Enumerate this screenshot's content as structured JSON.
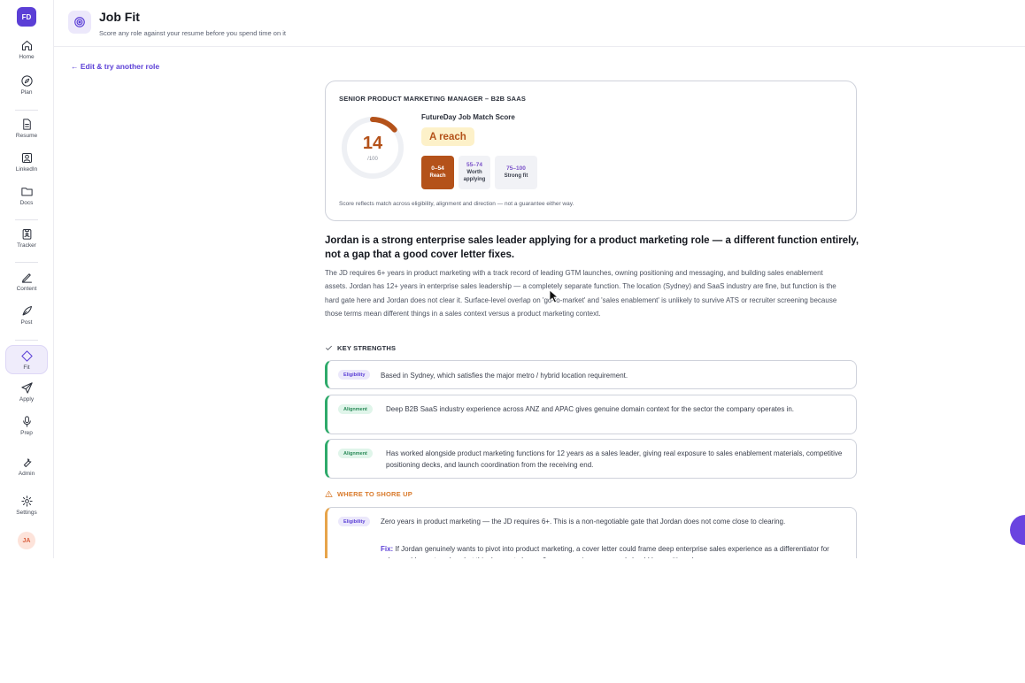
{
  "sidebar": {
    "brand": "FD",
    "items": [
      {
        "label": "Home"
      },
      {
        "label": "Plan"
      },
      {
        "label": "Resume"
      },
      {
        "label": "LinkedIn"
      },
      {
        "label": "Docs"
      },
      {
        "label": "Tracker"
      },
      {
        "label": "Content"
      },
      {
        "label": "Post"
      },
      {
        "label": "Fit"
      },
      {
        "label": "Apply"
      },
      {
        "label": "Prep"
      },
      {
        "label": "Admin"
      },
      {
        "label": "Settings"
      }
    ],
    "avatar": "JA"
  },
  "header": {
    "title": "Job Fit",
    "subtitle": "Score any role against your resume before you spend time on it"
  },
  "back_link": "← Edit & try another role",
  "score_card": {
    "role": "SENIOR PRODUCT MARKETING MANAGER – B2B SAAS",
    "score": "14",
    "score_max": "/100",
    "score_fraction": 0.14,
    "score_label": "FutureDay Job Match Score",
    "verdict": "A reach",
    "bands": [
      {
        "range": "0–54",
        "name": "Reach"
      },
      {
        "range": "55–74",
        "name_line1": "Worth",
        "name_line2": "applying"
      },
      {
        "range": "75–100",
        "name": "Strong fit"
      }
    ],
    "note": "Score reflects match across eligibility, alignment and direction — not a guarantee either way."
  },
  "assessment": {
    "headline": "Jordan is a strong enterprise sales leader applying for a product marketing role — a different function entirely, not a gap that a good cover letter fixes.",
    "body": "The JD requires 6+ years in product marketing with a track record of leading GTM launches, owning positioning and messaging, and building sales enablement assets. Jordan has 12+ years in enterprise sales leadership — a completely separate function. The location (Sydney) and SaaS industry are fine, but function is the hard gate here and Jordan does not clear it. Surface-level overlap on 'go-to-market' and 'sales enablement' is unlikely to survive ATS or recruiter screening because those terms mean different things in a sales context versus a product marketing context."
  },
  "strengths": {
    "heading": "KEY STRENGTHS",
    "items": [
      {
        "tag": "Eligibility",
        "text": "Based in Sydney, which satisfies the major metro / hybrid location requirement."
      },
      {
        "tag": "Alignment",
        "text": "Deep B2B SaaS industry experience across ANZ and APAC gives genuine domain context for the sector the company operates in."
      },
      {
        "tag": "Alignment",
        "text": "Has worked alongside product marketing functions for 12 years as a sales leader, giving real exposure to sales enablement materials, competitive positioning decks, and launch coordination from the receiving end."
      }
    ]
  },
  "shore_up": {
    "heading": "WHERE TO SHORE UP",
    "items": [
      {
        "tag": "Eligibility",
        "text": "Zero years in product marketing — the JD requires 6+. This is a non-negotiable gate that Jordan does not come close to clearing.",
        "fix_label": "Fix:",
        "fix_text": "If Jordan genuinely wants to pivot into product marketing, a cover letter could frame deep enterprise sales experience as a differentiator for sales enablement work — but this does not close a 6-year experience gap and should be positioned as a"
      }
    ]
  }
}
